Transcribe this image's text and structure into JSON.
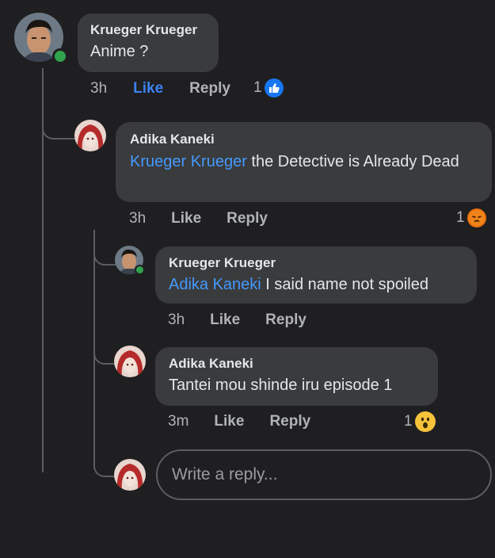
{
  "comments": [
    {
      "author": "Krueger Krueger",
      "mention": "",
      "text": "Anime ?",
      "time": "3h",
      "like": "Like",
      "reply": "Reply",
      "reaction_count": "1",
      "reaction_icon": "thumbs-up-icon"
    },
    {
      "author": "Adika Kaneki",
      "mention": "Krueger Krueger",
      "text": " the Detective is Already Dead",
      "time": "3h",
      "like": "Like",
      "reply": "Reply",
      "reaction_count": "1",
      "reaction_icon": "angry-icon"
    },
    {
      "author": "Krueger Krueger",
      "mention": "Adika Kaneki",
      "text": " I said name not spoiled",
      "time": "3h",
      "like": "Like",
      "reply": "Reply"
    },
    {
      "author": "Adika Kaneki",
      "mention": "",
      "text": "Tantei mou shinde iru episode 1",
      "time": "3m",
      "like": "Like",
      "reply": "Reply",
      "reaction_count": "1",
      "reaction_icon": "wow-icon"
    }
  ],
  "reply_box": {
    "placeholder": "Write a reply..."
  },
  "colors": {
    "background": "#1f1f21",
    "bubble": "#3a3b3c",
    "mention": "#4599ff",
    "like_active": "#3b82f6",
    "online": "#31a24c"
  }
}
